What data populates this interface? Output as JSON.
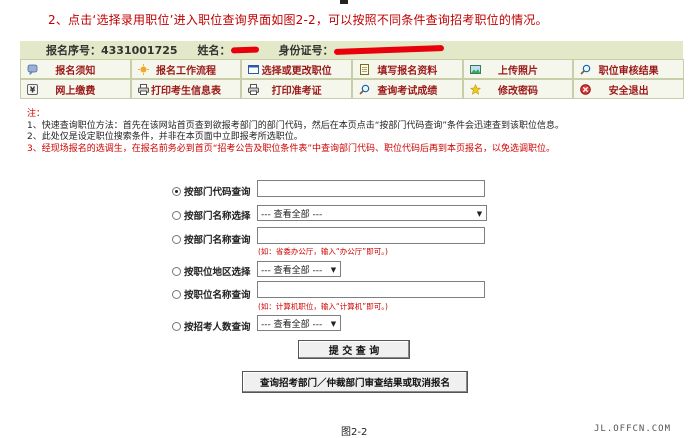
{
  "intro": "2、点击‘选择录用职位’进入职位查询界面如图2-2，可以按照不同条件查询招考职位的情况。",
  "infobar": {
    "reg_label": "报名序号：",
    "reg_value": "4331001725",
    "name_label": "姓名：",
    "id_label": "身份证号："
  },
  "menu": [
    {
      "label": "报名须知",
      "icon": "chat-bubble-icon"
    },
    {
      "label": "报名工作流程",
      "icon": "sun-icon"
    },
    {
      "label": "选择或更改职位",
      "icon": "window-icon"
    },
    {
      "label": "填写报名资料",
      "icon": "notepad-icon"
    },
    {
      "label": "上传照片",
      "icon": "picture-icon"
    },
    {
      "label": "职位审核结果",
      "icon": "magnifier-icon"
    },
    {
      "label": "网上缴费",
      "icon": "yen-icon"
    },
    {
      "label": "打印考生信息表",
      "icon": "printer-icon"
    },
    {
      "label": "打印准考证",
      "icon": "printer-icon"
    },
    {
      "label": "查询考试成绩",
      "icon": "magnifier-icon"
    },
    {
      "label": "修改密码",
      "icon": "star-icon"
    },
    {
      "label": "安全退出",
      "icon": "exit-icon"
    }
  ],
  "notes": {
    "title": "注：",
    "line1": "1、快速查询职位方法：首先在该网站首页查到欲报考部门的部门代码，然后在本页点击“按部门代码查询”条件会迅速查到该职位信息。",
    "line2": "2、此处仅是设定职位搜索条件，并非在本页面中立即报考所选职位。",
    "line3": "3、经现场报名的选调生，在报名前务必到首页“招考公告及职位条件表”中查询部门代码、职位代码后再到本页报名，以免选调职位。"
  },
  "form": {
    "r1": "按部门代码查询",
    "r2": "按部门名称选择",
    "r2_select": "--- 查看全部 ---",
    "r3": "按部门名称查询",
    "r3_hint": "(如：省委办公厅，输入“办公厅”即可。)",
    "r4": "按职位地区选择",
    "r4_select": "--- 查看全部 ---",
    "r5": "按职位名称查询",
    "r5_hint": "(如：计算机职位，输入“计算机”即可。)",
    "r6": "按招考人数查询",
    "r6_select": "--- 查看全部 ---",
    "submit": "提 交 查 询",
    "secondary": "查询招考部门／仲裁部门审查结果或取消报名"
  },
  "caption": "图2-2",
  "watermark": "JL.OFFCN.COM",
  "colors": {
    "accent_red": "#c00000",
    "bar_bg": "#e2e8c8",
    "menu_text": "#9b1a1a"
  }
}
